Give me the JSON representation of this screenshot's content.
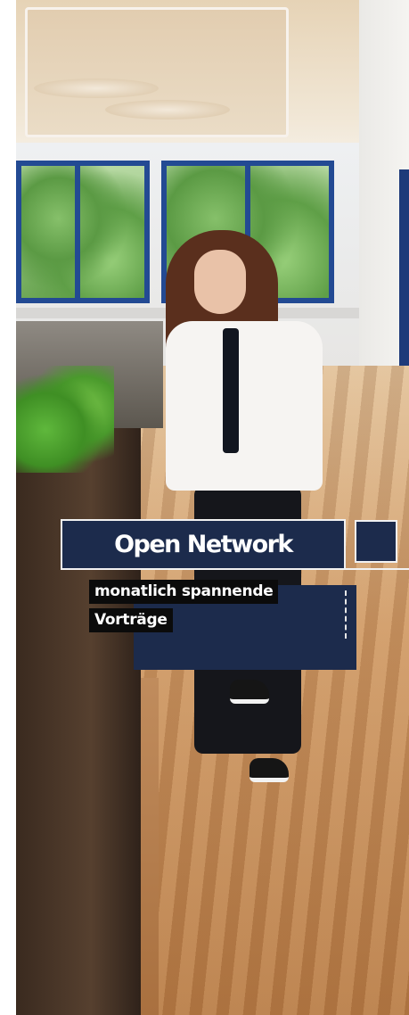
{
  "overlay": {
    "title": "Open Network",
    "subtitle_lines": [
      "monatlich spannende",
      "Vorträge"
    ]
  },
  "colors": {
    "panel_navy": "#1c2b4c",
    "label_black": "#0b0b0b",
    "text_white": "#ffffff",
    "frame_border": "#f1f1f1"
  }
}
